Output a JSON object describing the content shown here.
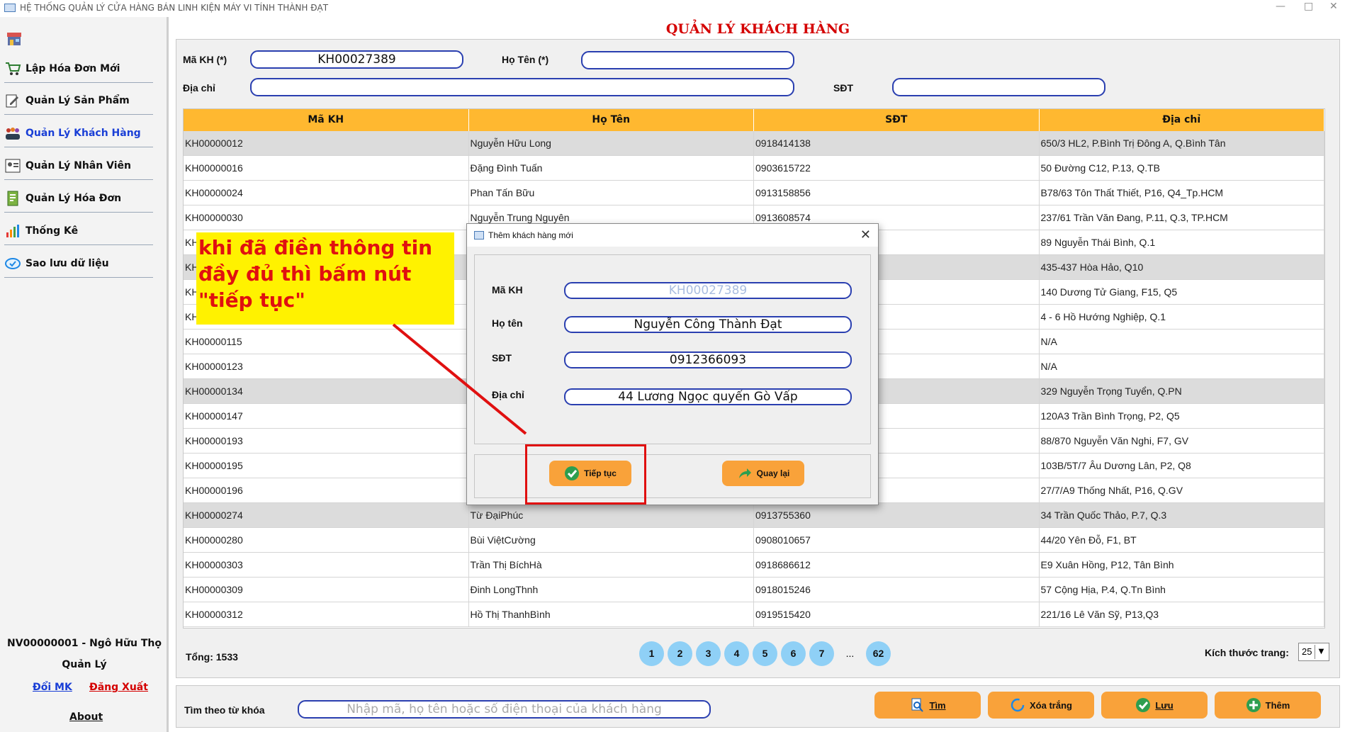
{
  "window": {
    "title": "HỆ THỐNG QUẢN LÝ CỬA HÀNG BÁN LINH KIỆN MÁY VI TÍNH THÀNH ĐẠT"
  },
  "sidebar": {
    "items": [
      {
        "label": "Lập Hóa Đơn Mới",
        "icon": "cart-icon"
      },
      {
        "label": "Quản Lý Sản Phẩm",
        "icon": "edit-icon"
      },
      {
        "label": "Quản Lý Khách Hàng",
        "icon": "customers-icon",
        "active": true
      },
      {
        "label": "Quản Lý Nhân Viên",
        "icon": "employee-icon"
      },
      {
        "label": "Quản Lý Hóa Đơn",
        "icon": "invoice-icon"
      },
      {
        "label": "Thống Kê",
        "icon": "chart-icon"
      },
      {
        "label": "Sao lưu dữ liệu",
        "icon": "backup-icon"
      }
    ],
    "user_line": "NV00000001 - Ngô Hữu  Thọ",
    "role": "Quản Lý",
    "change_password": "Đổi MK",
    "logout": "Đăng Xuất",
    "about": "About"
  },
  "page": {
    "title": "QUẢN LÝ KHÁCH HÀNG",
    "form": {
      "ma_kh_label": "Mã KH (*)",
      "ma_kh_value": "KH00027389",
      "ho_ten_label": "Họ Tên (*)",
      "ho_ten_value": "",
      "dia_chi_label": "Địa chỉ",
      "dia_chi_value": "",
      "sdt_label": "SĐT",
      "sdt_value": ""
    }
  },
  "table": {
    "columns": [
      "Mã KH",
      "Họ Tên",
      "SĐT",
      "Địa chỉ"
    ],
    "rows": [
      [
        "KH00000012",
        "Nguyễn Hữu Long",
        "0918414138",
        "650/3 HL2, P.Bình Trị Đông A, Q.Bình Tân"
      ],
      [
        "KH00000016",
        "Đặng Đình Tuấn",
        "0903615722",
        "50 Đường C12, P.13, Q.TB"
      ],
      [
        "KH00000024",
        "Phan Tấn Bữu",
        "0913158856",
        "B78/63 Tôn Thất Thiết, P16, Q4_Tp.HCM"
      ],
      [
        "KH00000030",
        "Nguyễn Trung Nguyên",
        "0913608574",
        "237/61 Trần Văn Đang, P.11, Q.3, TP.HCM"
      ],
      [
        "KH",
        "",
        "",
        "89 Nguyễn Thái Bình, Q.1"
      ],
      [
        "KH",
        "",
        "",
        "435-437 Hòa Hảo, Q10"
      ],
      [
        "KH",
        "",
        "",
        "140 Dương Tử Giang, F15, Q5"
      ],
      [
        "KH",
        "",
        "",
        "4 - 6 Hồ Hướng Nghiệp, Q.1"
      ],
      [
        "KH00000115",
        "",
        "",
        "N/A"
      ],
      [
        "KH00000123",
        "",
        "",
        "N/A"
      ],
      [
        "KH00000134",
        "",
        "",
        "329 Nguyễn Trọng Tuyển, Q.PN"
      ],
      [
        "KH00000147",
        "",
        "",
        "120A3 Trần Bình Trọng, P2, Q5"
      ],
      [
        "KH00000193",
        "",
        "",
        "88/870 Nguyễn Văn Nghi, F7, GV"
      ],
      [
        "KH00000195",
        "",
        "",
        "103B/5T/7 Âu Dương Lân, P2, Q8"
      ],
      [
        "KH00000196",
        "",
        "",
        "27/7/A9 Thống Nhất, P16, Q.GV"
      ],
      [
        "KH00000274",
        "Từ ĐạiPhúc",
        "0913755360",
        "34 Trần Quốc Thảo, P.7, Q.3"
      ],
      [
        "KH00000280",
        "Bùi ViệtCường",
        "0908010657",
        "44/20 Yên Đỗ, F1, BT"
      ],
      [
        "KH00000303",
        "Trần Thị BíchHà",
        "0918686612",
        "E9 Xuân Hồng, P12, Tân Bình"
      ],
      [
        "KH00000309",
        "Đinh LongThnh",
        "0918015246",
        "57 Cộng Hịa, P.4, Q.Tn Bình"
      ],
      [
        "KH00000312",
        "Hồ Thị ThanhBình",
        "0919515420",
        "221/16 Lê Văn Sỹ, P13,Q3"
      ]
    ],
    "alt_rows": [
      0,
      5,
      10,
      15
    ]
  },
  "pagination": {
    "total": "Tổng: 1533",
    "pages": [
      "1",
      "2",
      "3",
      "4",
      "5",
      "6",
      "7",
      "...",
      "62"
    ],
    "page_size_label": "Kích thước trang:",
    "page_size_value": "25"
  },
  "search": {
    "label": "Tìm theo từ khóa",
    "placeholder": "Nhập mã, họ tên hoặc số điện thoại của khách hàng"
  },
  "actions": {
    "search": "Tìm",
    "clear": "Xóa trắng",
    "save": "Lưu",
    "add": "Thêm"
  },
  "dialog": {
    "title": "Thêm khách hàng mới",
    "ma_kh_label": "Mã KH",
    "ma_kh_value": "KH00027389",
    "ho_ten_label": "Họ tên",
    "ho_ten_value": "Nguyễn Công Thành Đạt",
    "sdt_label": "SĐT",
    "sdt_value": "0912366093",
    "dia_chi_label": "Địa chỉ",
    "dia_chi_value": "44 Lương Ngọc quyến Gò Vấp",
    "continue_button": "Tiếp tục",
    "back_button": "Quay lại"
  },
  "annotation": {
    "text": "khi đã điền thông tin đầy đủ thì bấm nút \"tiếp tục\""
  },
  "colors": {
    "accent_orange": "#f9a23a",
    "header_orange": "#ffb830",
    "title_red": "#d40000",
    "field_border": "#2a3fb0",
    "annotation_yellow": "#fff200",
    "annotation_red": "#e01010"
  }
}
